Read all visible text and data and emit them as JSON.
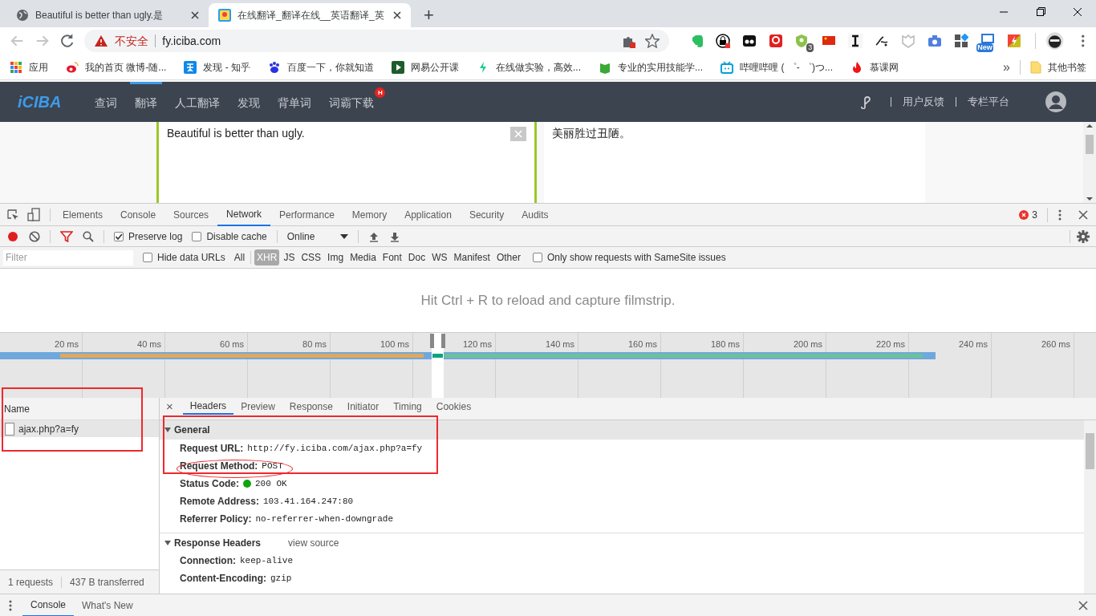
{
  "browser": {
    "tabs": [
      {
        "title": "Beautiful is better than ugly.是",
        "selected": false,
        "kind": "globe"
      },
      {
        "title": "在线翻译_翻译在线__英语翻译_英",
        "selected": true,
        "kind": "iciba"
      }
    ],
    "new_tab": "+",
    "security_label": "不安全",
    "url": "fy.iciba.com",
    "extensions": [
      {
        "kind": "evernote"
      },
      {
        "kind": "lock"
      },
      {
        "kind": "tracker"
      },
      {
        "kind": "redface"
      },
      {
        "kind": "shield",
        "badge": "3"
      },
      {
        "kind": "flag"
      },
      {
        "kind": "serif"
      },
      {
        "kind": "en"
      },
      {
        "kind": "ghost"
      },
      {
        "kind": "camera"
      },
      {
        "kind": "blocks"
      },
      {
        "kind": "newbadge",
        "badge": "New"
      },
      {
        "kind": "bolt"
      }
    ],
    "bookmarks": [
      {
        "label": "应用",
        "kind": "apps"
      },
      {
        "label": "我的首页 微博-随...",
        "kind": "weibo"
      },
      {
        "label": "发现 - 知乎",
        "kind": "zhihu"
      },
      {
        "label": "百度一下，你就知道",
        "kind": "paw"
      },
      {
        "label": "网易公开课",
        "kind": "play"
      },
      {
        "label": "在线做实验，高效...",
        "kind": "leaf"
      },
      {
        "label": "专业的实用技能学...",
        "kind": "book"
      },
      {
        "label": "哔哩哔哩 ( ゜- ゜)つ...",
        "kind": "tv"
      },
      {
        "label": "慕课网",
        "kind": "flame"
      }
    ],
    "more": "»",
    "other_bookmarks": "其他书签"
  },
  "site": {
    "logo": "iCIBA",
    "nav": [
      {
        "label": "查词",
        "selected": false
      },
      {
        "label": "翻译",
        "selected": true
      },
      {
        "label": "人工翻译",
        "selected": false
      },
      {
        "label": "发现",
        "selected": false
      },
      {
        "label": "背单词",
        "selected": false
      },
      {
        "label": "词霸下载",
        "selected": false,
        "badge": "H"
      }
    ],
    "right_links": [
      "用户反馈",
      "专栏平台"
    ],
    "source_text": "Beautiful is better than ugly.",
    "translation": "美丽胜过丑陋。"
  },
  "devtools": {
    "tabs": [
      {
        "label": "Elements",
        "selected": false
      },
      {
        "label": "Console",
        "selected": false
      },
      {
        "label": "Sources",
        "selected": false
      },
      {
        "label": "Network",
        "selected": true
      },
      {
        "label": "Performance",
        "selected": false
      },
      {
        "label": "Memory",
        "selected": false
      },
      {
        "label": "Application",
        "selected": false
      },
      {
        "label": "Security",
        "selected": false
      },
      {
        "label": "Audits",
        "selected": false
      }
    ],
    "error_count": "3",
    "recording": true,
    "preserve_log": {
      "label": "Preserve log",
      "checked": true
    },
    "disable_cache": {
      "label": "Disable cache",
      "checked": false
    },
    "throttle": "Online",
    "filter_placeholder": "Filter",
    "hide_data_urls": {
      "label": "Hide data URLs",
      "checked": false
    },
    "types": [
      {
        "label": "All",
        "selected": false
      },
      {
        "label": "XHR",
        "selected": true
      },
      {
        "label": "JS",
        "selected": false
      },
      {
        "label": "CSS",
        "selected": false
      },
      {
        "label": "Img",
        "selected": false
      },
      {
        "label": "Media",
        "selected": false
      },
      {
        "label": "Font",
        "selected": false
      },
      {
        "label": "Doc",
        "selected": false
      },
      {
        "label": "WS",
        "selected": false
      },
      {
        "label": "Manifest",
        "selected": false
      },
      {
        "label": "Other",
        "selected": false
      }
    ],
    "samesite_only": {
      "label": "Only show requests with SameSite issues",
      "checked": false
    },
    "filmstrip_hint": "Hit Ctrl + R to reload and capture filmstrip.",
    "ticks": [
      "20 ms",
      "40 ms",
      "60 ms",
      "80 ms",
      "100 ms",
      "120 ms",
      "140 ms",
      "160 ms",
      "180 ms",
      "200 ms",
      "220 ms",
      "240 ms",
      "260 ms"
    ],
    "name_header": "Name",
    "requests": [
      {
        "name": "ajax.php?a=fy",
        "selected": true
      }
    ],
    "summary": [
      "1 requests",
      "437 B transferred"
    ],
    "detail_close": "×",
    "detail_tabs": [
      {
        "label": "Headers",
        "selected": true
      },
      {
        "label": "Preview",
        "selected": false
      },
      {
        "label": "Response",
        "selected": false
      },
      {
        "label": "Initiator",
        "selected": false
      },
      {
        "label": "Timing",
        "selected": false
      },
      {
        "label": "Cookies",
        "selected": false
      }
    ],
    "general": {
      "title": "General",
      "expanded": true,
      "rows": [
        {
          "label": "Request URL:",
          "value": "http://fy.iciba.com/ajax.php?a=fy"
        },
        {
          "label": "Request Method:",
          "value": "POST"
        },
        {
          "label": "Status Code:",
          "value": "200 OK",
          "color": "#0ea50e"
        },
        {
          "label": "Remote Address:",
          "value": "103.41.164.247:80"
        },
        {
          "label": "Referrer Policy:",
          "value": "no-referrer-when-downgrade"
        }
      ]
    },
    "response_headers": {
      "title": "Response Headers",
      "expanded": true,
      "link": "view source",
      "rows": [
        {
          "label": "Connection:",
          "value": "keep-alive"
        },
        {
          "label": "Content-Encoding:",
          "value": "gzip"
        }
      ]
    },
    "drawer_tabs": [
      {
        "label": "Console",
        "selected": true
      },
      {
        "label": "What's New",
        "selected": false
      }
    ]
  }
}
